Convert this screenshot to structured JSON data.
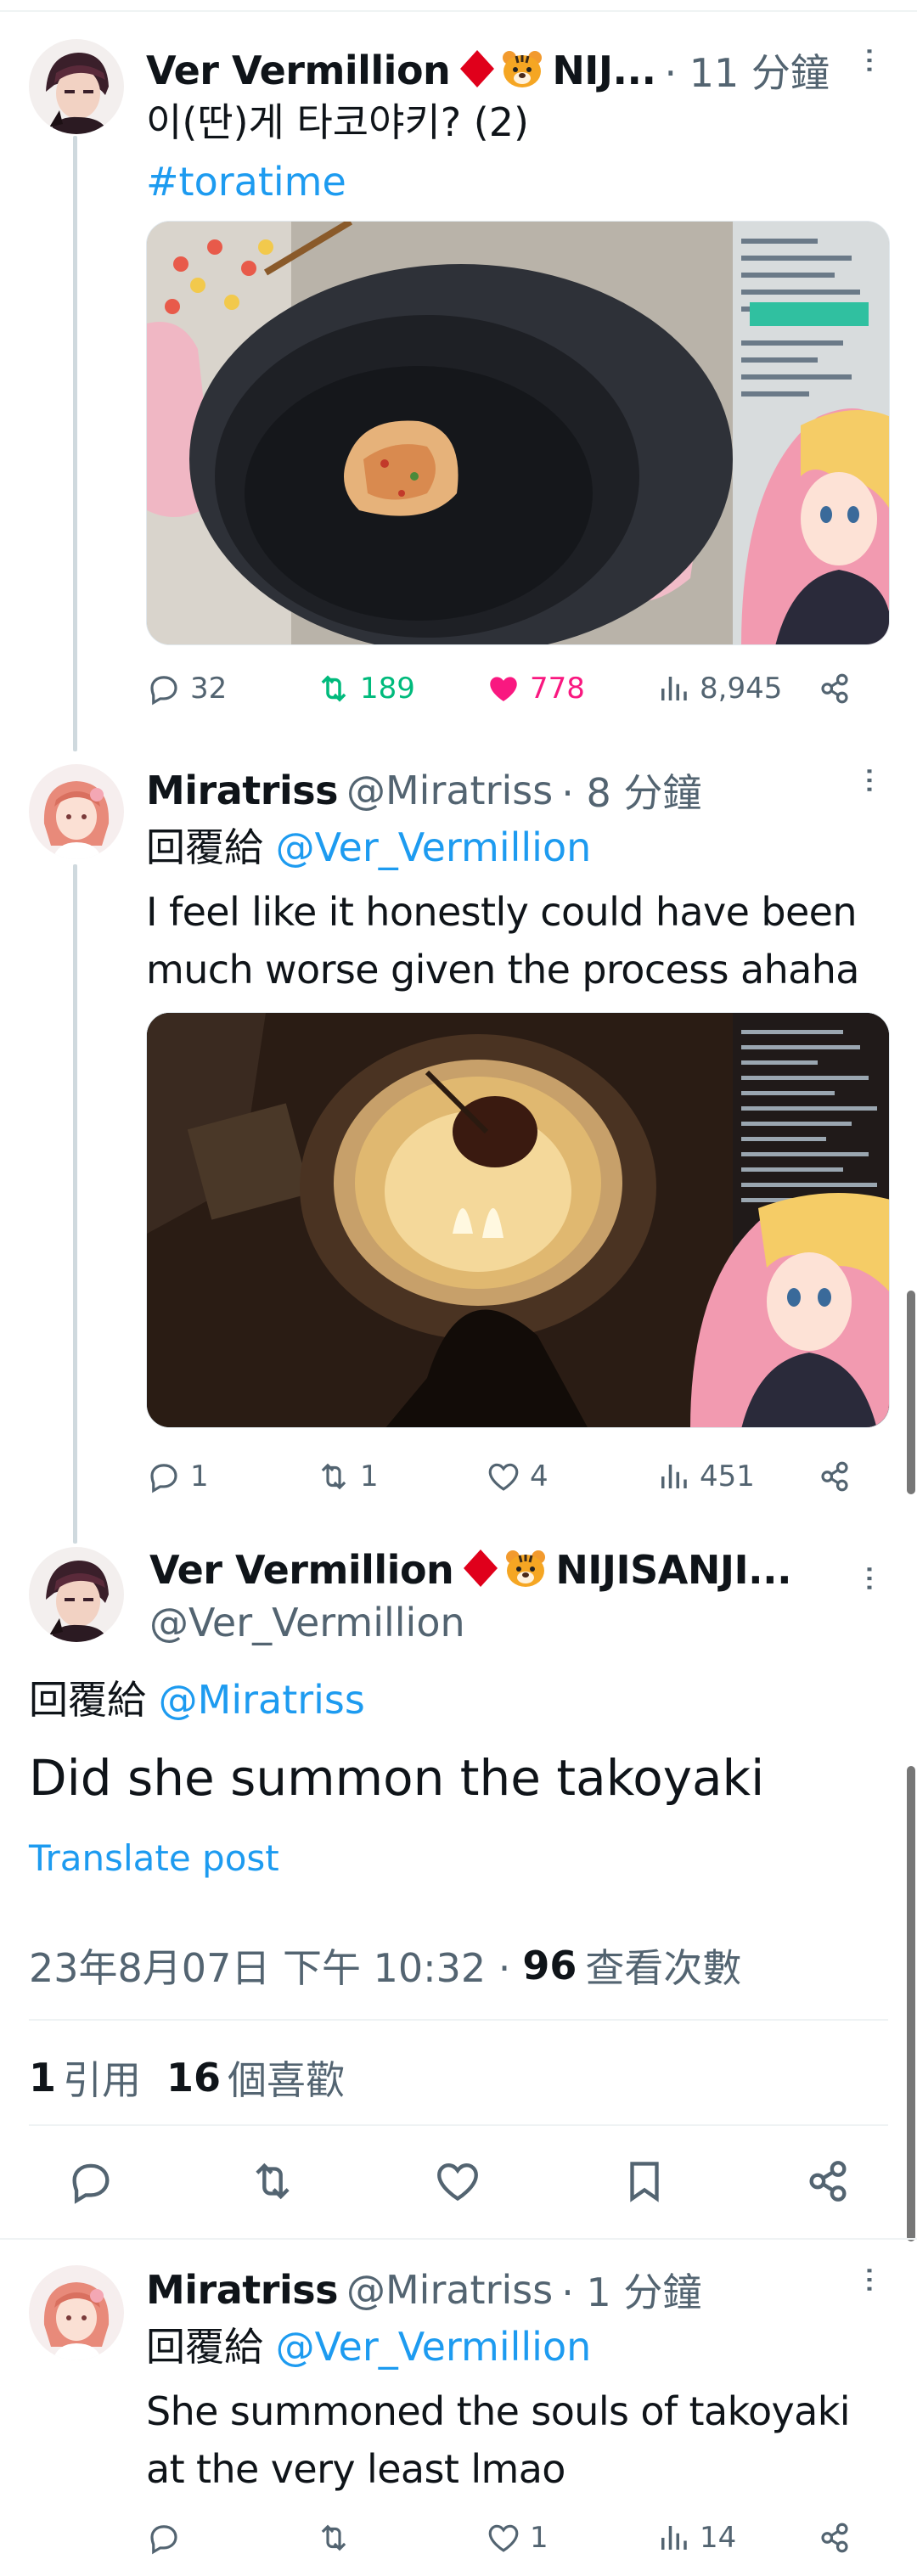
{
  "post1": {
    "name": "Ver Vermillion",
    "name_trunc": "NIJ...",
    "time": "· 11 分鐘",
    "more": "···",
    "text": "이(딴)게 타코야키? (2)",
    "hashtag": "#toratime",
    "stats": {
      "replies": "32",
      "reposts": "189",
      "likes": "778",
      "views": "8,945"
    },
    "colors": {
      "repost": "#00ba7c",
      "like": "#f91880"
    }
  },
  "post2": {
    "name": "Miratriss",
    "handle": "@Miratriss",
    "time": "· 8 分鐘",
    "more": "···",
    "reply_prefix": "回覆給",
    "reply_to": "@Ver_Vermillion",
    "text_line1": "I feel like it honestly could have been",
    "text_line2": "much worse given the process ahaha",
    "stats": {
      "replies": "1",
      "reposts": "1",
      "likes": "4",
      "views": "451"
    }
  },
  "focus": {
    "name": "Ver Vermillion",
    "name_trunc": "NIJISANJI...",
    "handle": "@Ver_Vermillion",
    "more": "···",
    "reply_prefix": "回覆給",
    "reply_to": "@Miratriss",
    "text": "Did she summon the takoyaki",
    "translate": "Translate post",
    "timestamp": "23年8月07日 下午 10:32 ·",
    "views_count": "96",
    "views_label": "查看次數",
    "quotes_count": "1",
    "quotes_label": "引用",
    "likes_count": "16",
    "likes_label": "個喜歡"
  },
  "post3": {
    "name": "Miratriss",
    "handle": "@Miratriss",
    "time": "· 1 分鐘",
    "more": "···",
    "reply_prefix": "回覆給",
    "reply_to": "@Ver_Vermillion",
    "text_line1": "She summoned the souls of takoyaki",
    "text_line2": "at the very least lmao",
    "stats": {
      "replies": "",
      "reposts": "",
      "likes": "1",
      "views": "14"
    }
  },
  "colors": {
    "accent": "#1d9bf0",
    "text": "#0f1419",
    "muted": "#536471",
    "badge_red": "#e0001b"
  }
}
